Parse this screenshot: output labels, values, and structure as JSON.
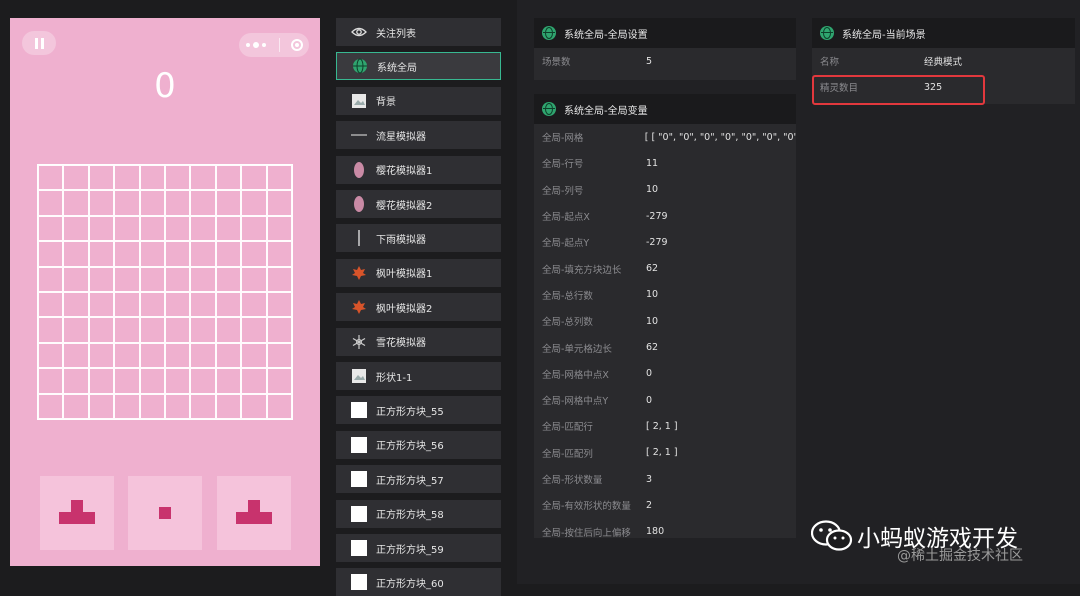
{
  "colors": {
    "game_bg": "#efb0cf",
    "block": "#c8336d",
    "selected_border": "#38b891",
    "highlight": "#e2383d",
    "globe": "#2fa56f"
  },
  "game": {
    "score": "0",
    "board": {
      "rows": 10,
      "cols": 10
    },
    "icons": [
      "pause-icon",
      "more-dots-icon",
      "close-target-icon"
    ]
  },
  "nodes": [
    {
      "label": "关注列表",
      "icon": "eye-icon"
    },
    {
      "label": "系统全局",
      "icon": "globe-icon",
      "selected": true
    },
    {
      "label": "背景",
      "icon": "image-icon"
    },
    {
      "label": "流星模拟器",
      "icon": "meteor-icon"
    },
    {
      "label": "樱花模拟器1",
      "icon": "petal-icon"
    },
    {
      "label": "樱花模拟器2",
      "icon": "petal-icon"
    },
    {
      "label": "下雨模拟器",
      "icon": "rain-icon"
    },
    {
      "label": "枫叶模拟器1",
      "icon": "maple-leaf-icon"
    },
    {
      "label": "枫叶模拟器2",
      "icon": "maple-leaf-icon"
    },
    {
      "label": "雪花模拟器",
      "icon": "snowflake-icon"
    },
    {
      "label": "形状1-1",
      "icon": "image-icon"
    },
    {
      "label": "正方形方块_55",
      "icon": "white-square-icon"
    },
    {
      "label": "正方形方块_56",
      "icon": "white-square-icon"
    },
    {
      "label": "正方形方块_57",
      "icon": "white-square-icon"
    },
    {
      "label": "正方形方块_58",
      "icon": "white-square-icon"
    },
    {
      "label": "正方形方块_59",
      "icon": "white-square-icon"
    },
    {
      "label": "正方形方块_60",
      "icon": "white-square-icon"
    }
  ],
  "settings_panel": {
    "title": "系统全局-全局设置",
    "rows": [
      {
        "key": "场景数",
        "value": "5"
      }
    ]
  },
  "variables_panel": {
    "title": "系统全局-全局变量",
    "rows": [
      {
        "key": "全局-网格",
        "value": "[ [ \"0\", \"0\", \"0\", \"0\", \"0\", \"0\", \"0\""
      },
      {
        "key": "全局-行号",
        "value": "11"
      },
      {
        "key": "全局-列号",
        "value": "10"
      },
      {
        "key": "全局-起点X",
        "value": "-279"
      },
      {
        "key": "全局-起点Y",
        "value": "-279"
      },
      {
        "key": "全局-填充方块边长",
        "value": "62"
      },
      {
        "key": "全局-总行数",
        "value": "10"
      },
      {
        "key": "全局-总列数",
        "value": "10"
      },
      {
        "key": "全局-单元格边长",
        "value": "62"
      },
      {
        "key": "全局-网格中点X",
        "value": "0"
      },
      {
        "key": "全局-网格中点Y",
        "value": "0"
      },
      {
        "key": "全局-匹配行",
        "value": "[ 2, 1 ]"
      },
      {
        "key": "全局-匹配列",
        "value": "[ 2, 1 ]"
      },
      {
        "key": "全局-形状数量",
        "value": "3"
      },
      {
        "key": "全局-有效形状的数量",
        "value": "2"
      },
      {
        "key": "全局-按住后向上偏移",
        "value": "180"
      }
    ]
  },
  "scene_panel": {
    "title": "系统全局-当前场景",
    "rows": [
      {
        "key": "名称",
        "value": "经典模式"
      },
      {
        "key": "精灵数目",
        "value": "325"
      }
    ]
  },
  "watermark": {
    "title": "小蚂蚁游戏开发",
    "subtitle": "@稀土掘金技术社区"
  }
}
